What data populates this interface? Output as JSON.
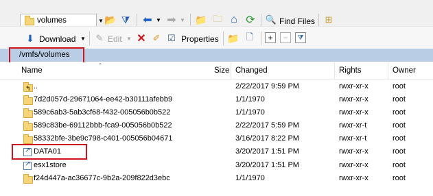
{
  "toolbar1": {
    "location_value": "volumes",
    "find_files_label": "Find Files"
  },
  "toolbar2": {
    "download_label": "Download",
    "edit_label": "Edit",
    "properties_label": "Properties"
  },
  "path": {
    "current": "/vmfs/volumes"
  },
  "columns": {
    "name": "Name",
    "size": "Size",
    "changed": "Changed",
    "rights": "Rights",
    "owner": "Owner"
  },
  "files": [
    {
      "name": "..",
      "size": "",
      "changed": "2/22/2017 9:59 PM",
      "rights": "rwxr-xr-x",
      "owner": "root",
      "type": "parent"
    },
    {
      "name": "7d2d057d-29671064-ee42-b30111afebb9",
      "size": "",
      "changed": "1/1/1970",
      "rights": "rwxr-xr-x",
      "owner": "root",
      "type": "folder"
    },
    {
      "name": "589c6ab3-5ab3cf68-f432-005056b0b522",
      "size": "",
      "changed": "1/1/1970",
      "rights": "rwxr-xr-x",
      "owner": "root",
      "type": "folder"
    },
    {
      "name": "589c83be-69112bbb-fca9-005056b0b522",
      "size": "",
      "changed": "2/22/2017 5:59 PM",
      "rights": "rwxr-xr-t",
      "owner": "root",
      "type": "folder"
    },
    {
      "name": "58332bfe-3be9c798-c401-005056b04671",
      "size": "",
      "changed": "3/16/2017 8:22 PM",
      "rights": "rwxr-xr-t",
      "owner": "root",
      "type": "folder"
    },
    {
      "name": "DATA01",
      "size": "",
      "changed": "3/20/2017 1:51 PM",
      "rights": "rwxr-xr-x",
      "owner": "root",
      "type": "link"
    },
    {
      "name": "esx1store",
      "size": "",
      "changed": "3/20/2017 1:51 PM",
      "rights": "rwxr-xr-x",
      "owner": "root",
      "type": "link"
    },
    {
      "name": "f24d447a-ac36677c-9b2a-209f822d3ebc",
      "size": "",
      "changed": "1/1/1970",
      "rights": "rwxr-xr-x",
      "owner": "root",
      "type": "folder"
    }
  ],
  "colors": {
    "path_bar": "#b9cde4",
    "highlight": "#d0141c",
    "folder": "#f6d47a"
  }
}
